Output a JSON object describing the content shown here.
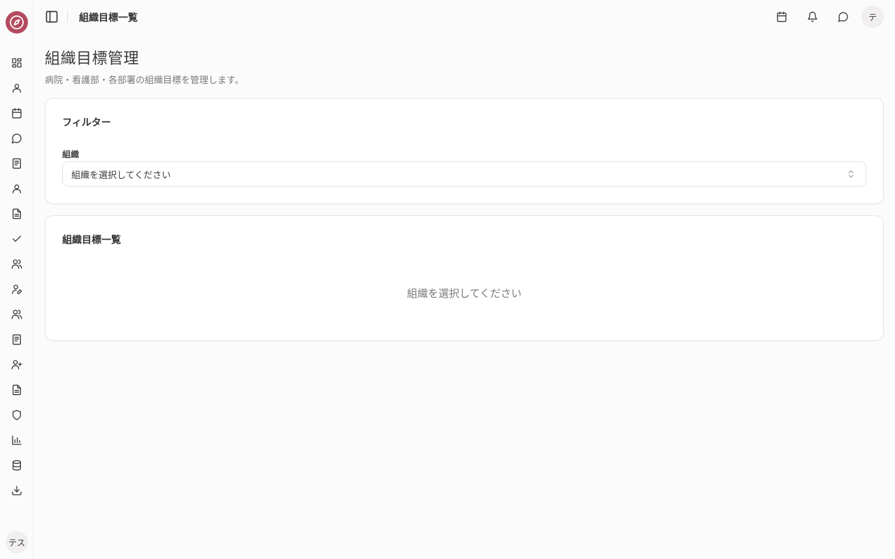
{
  "sidebar": {
    "logo_icon": "compass-logo-icon",
    "accent_color": "#b34a5f",
    "items": [
      {
        "icon": "dashboard-grid-icon"
      },
      {
        "icon": "user-icon"
      },
      {
        "icon": "calendar-icon"
      },
      {
        "icon": "message-icon"
      },
      {
        "icon": "notebook-icon"
      },
      {
        "icon": "user-icon"
      },
      {
        "icon": "file-text-icon"
      },
      {
        "icon": "check-icon"
      },
      {
        "icon": "users-icon"
      },
      {
        "icon": "user-pen-icon"
      },
      {
        "icon": "users-icon"
      },
      {
        "icon": "notebook-icon"
      },
      {
        "icon": "user-plus-icon"
      },
      {
        "icon": "file-text-icon"
      },
      {
        "icon": "shield-icon"
      },
      {
        "icon": "bar-chart-icon"
      },
      {
        "icon": "database-icon"
      },
      {
        "icon": "download-icon"
      }
    ],
    "user_avatar_text": "テス"
  },
  "header": {
    "title": "組織目標一覧",
    "avatar_text": "テ"
  },
  "main": {
    "page_title": "組織目標管理",
    "page_subtitle": "病院・看護部・各部署の組織目標を管理します。",
    "filter_card": {
      "title": "フィルター",
      "organization_label": "組織",
      "organization_select_value": "組織を選択してください"
    },
    "list_card": {
      "title": "組織目標一覧",
      "empty_message": "組織を選択してください"
    }
  }
}
